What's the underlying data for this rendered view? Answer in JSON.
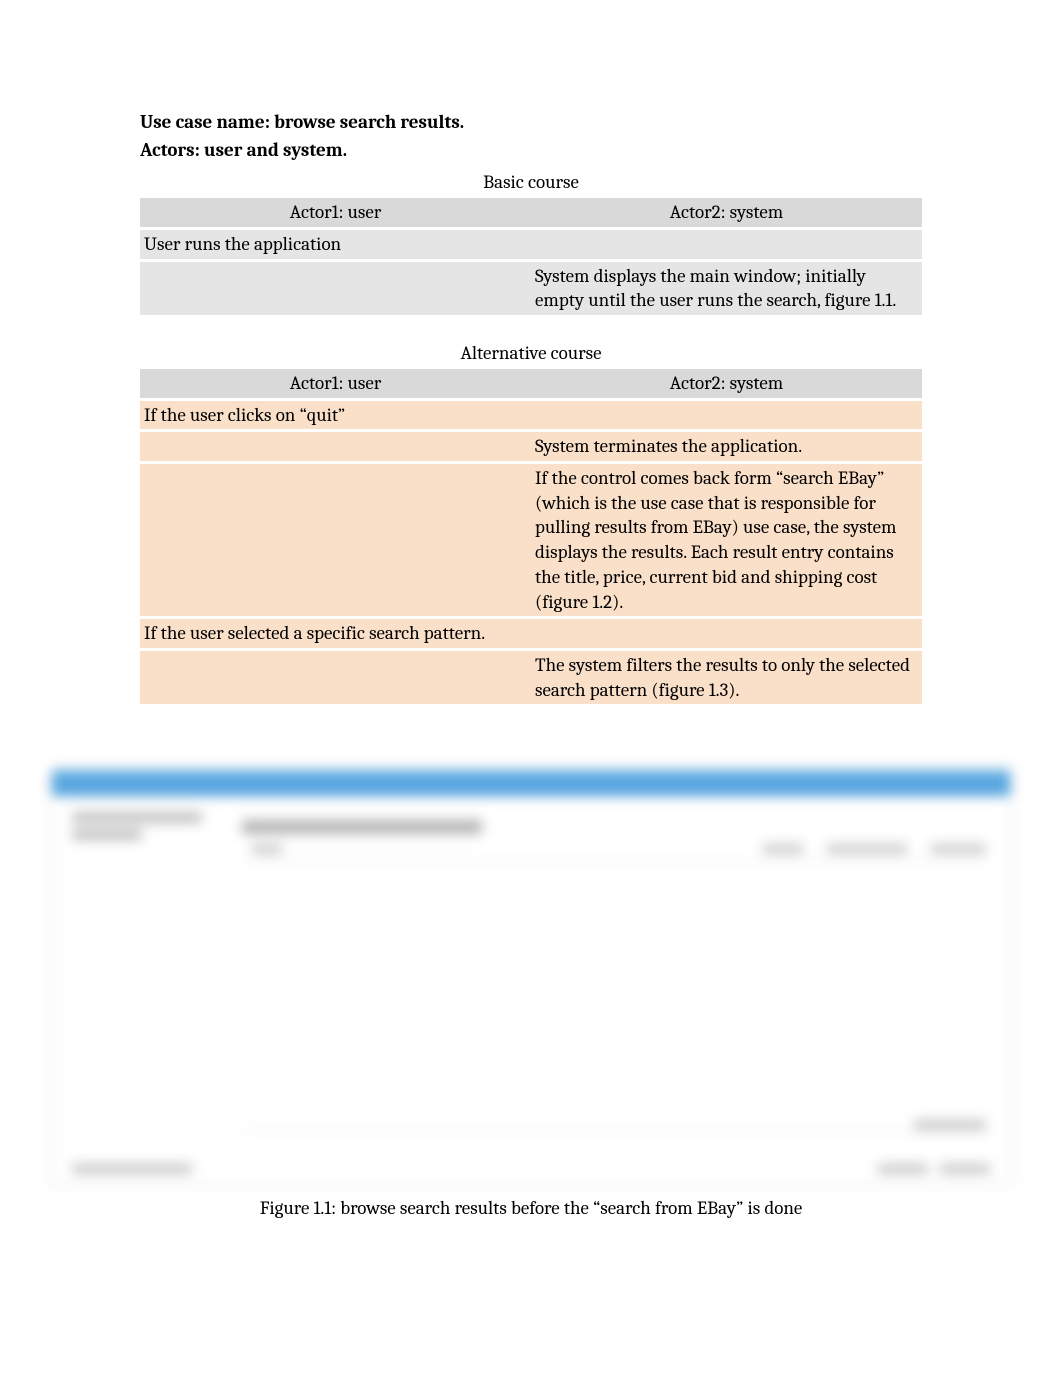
{
  "headings": {
    "use_case": "Use case name: browse search results.",
    "actors": "Actors: user and system."
  },
  "basic": {
    "caption": "Basic course",
    "header": {
      "actor1": "Actor1: user",
      "actor2": "Actor2: system"
    },
    "rows": [
      {
        "left": "User runs the application",
        "right": ""
      },
      {
        "left": "",
        "right": "System displays the main window; initially empty until the user runs the search, figure 1.1."
      }
    ]
  },
  "alternative": {
    "caption": "Alternative course",
    "header": {
      "actor1": "Actor1: user",
      "actor2": "Actor2: system"
    },
    "rows": [
      {
        "left": "If the user clicks on “quit”",
        "right": ""
      },
      {
        "left": "",
        "right": "System terminates the application."
      },
      {
        "left": "",
        "right": "If the control comes back form “search EBay” (which is the use case that is responsible for pulling results from EBay) use case, the system displays the results. Each result entry contains the title, price, current bid and shipping cost (figure 1.2)."
      },
      {
        "left": "If the user selected a specific search pattern.",
        "right": ""
      },
      {
        "left": "",
        "right": "The system filters the results to only the selected search pattern (figure 1.3)."
      }
    ]
  },
  "figure": {
    "caption": "Figure 1.1: browse search results before the “search from EBay” is done"
  }
}
